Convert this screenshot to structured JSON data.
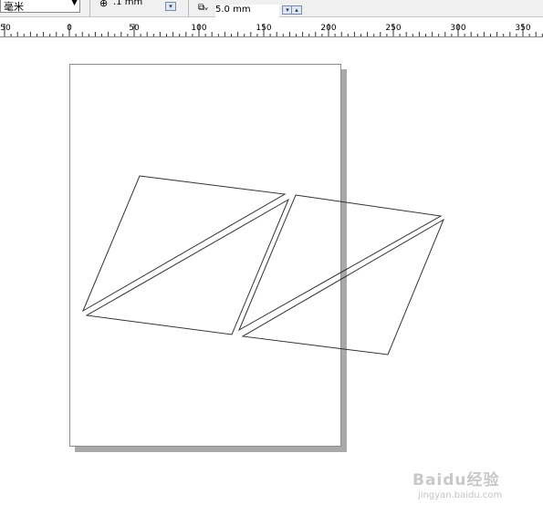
{
  "toolbar": {
    "units_value": "毫米",
    "nudge_value": ".1 mm",
    "duplicate_distance_value": "5.0 mm"
  },
  "ruler": {
    "labels": [
      "50",
      "0",
      "50",
      "100",
      "150",
      "200",
      "250",
      "300",
      "350"
    ]
  },
  "watermark": {
    "logo_text": "Baidu经验",
    "url_text": "jingyan.baidu.com"
  }
}
